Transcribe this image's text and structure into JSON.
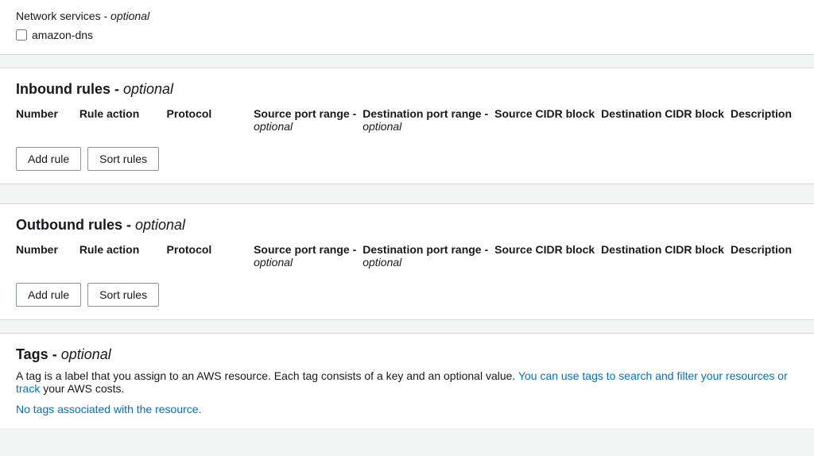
{
  "top": {
    "network_services_label": "Network services",
    "optional_label": "optional",
    "checkbox_label": "amazon-dns"
  },
  "inbound": {
    "title": "Inbound rules",
    "optional": "optional",
    "columns": {
      "number": "Number",
      "rule_action": "Rule action",
      "protocol": "Protocol",
      "source_port": "Source port range -",
      "source_port_optional": "optional",
      "dest_port": "Destination port range -",
      "dest_port_optional": "optional",
      "source_cidr": "Source CIDR block",
      "dest_cidr": "Destination CIDR block",
      "description": "Description"
    },
    "add_rule": "Add rule",
    "sort_rules": "Sort rules"
  },
  "outbound": {
    "title": "Outbound rules",
    "optional": "optional",
    "columns": {
      "number": "Number",
      "rule_action": "Rule action",
      "protocol": "Protocol",
      "source_port": "Source port range -",
      "source_port_optional": "optional",
      "dest_port": "Destination port range -",
      "dest_port_optional": "optional",
      "source_cidr": "Source CIDR block",
      "dest_cidr": "Destination CIDR block",
      "description": "Description"
    },
    "add_rule": "Add rule",
    "sort_rules": "Sort rules"
  },
  "tags": {
    "title": "Tags",
    "optional": "optional",
    "description": "A tag is a label that you assign to an AWS resource. Each tag consists of a key and an optional value.",
    "link1_text": "You can use tags to search and filter your resources or",
    "link2_text": "track",
    "link3_text": "your AWS costs.",
    "no_tags": "No tags associated with the resource."
  }
}
